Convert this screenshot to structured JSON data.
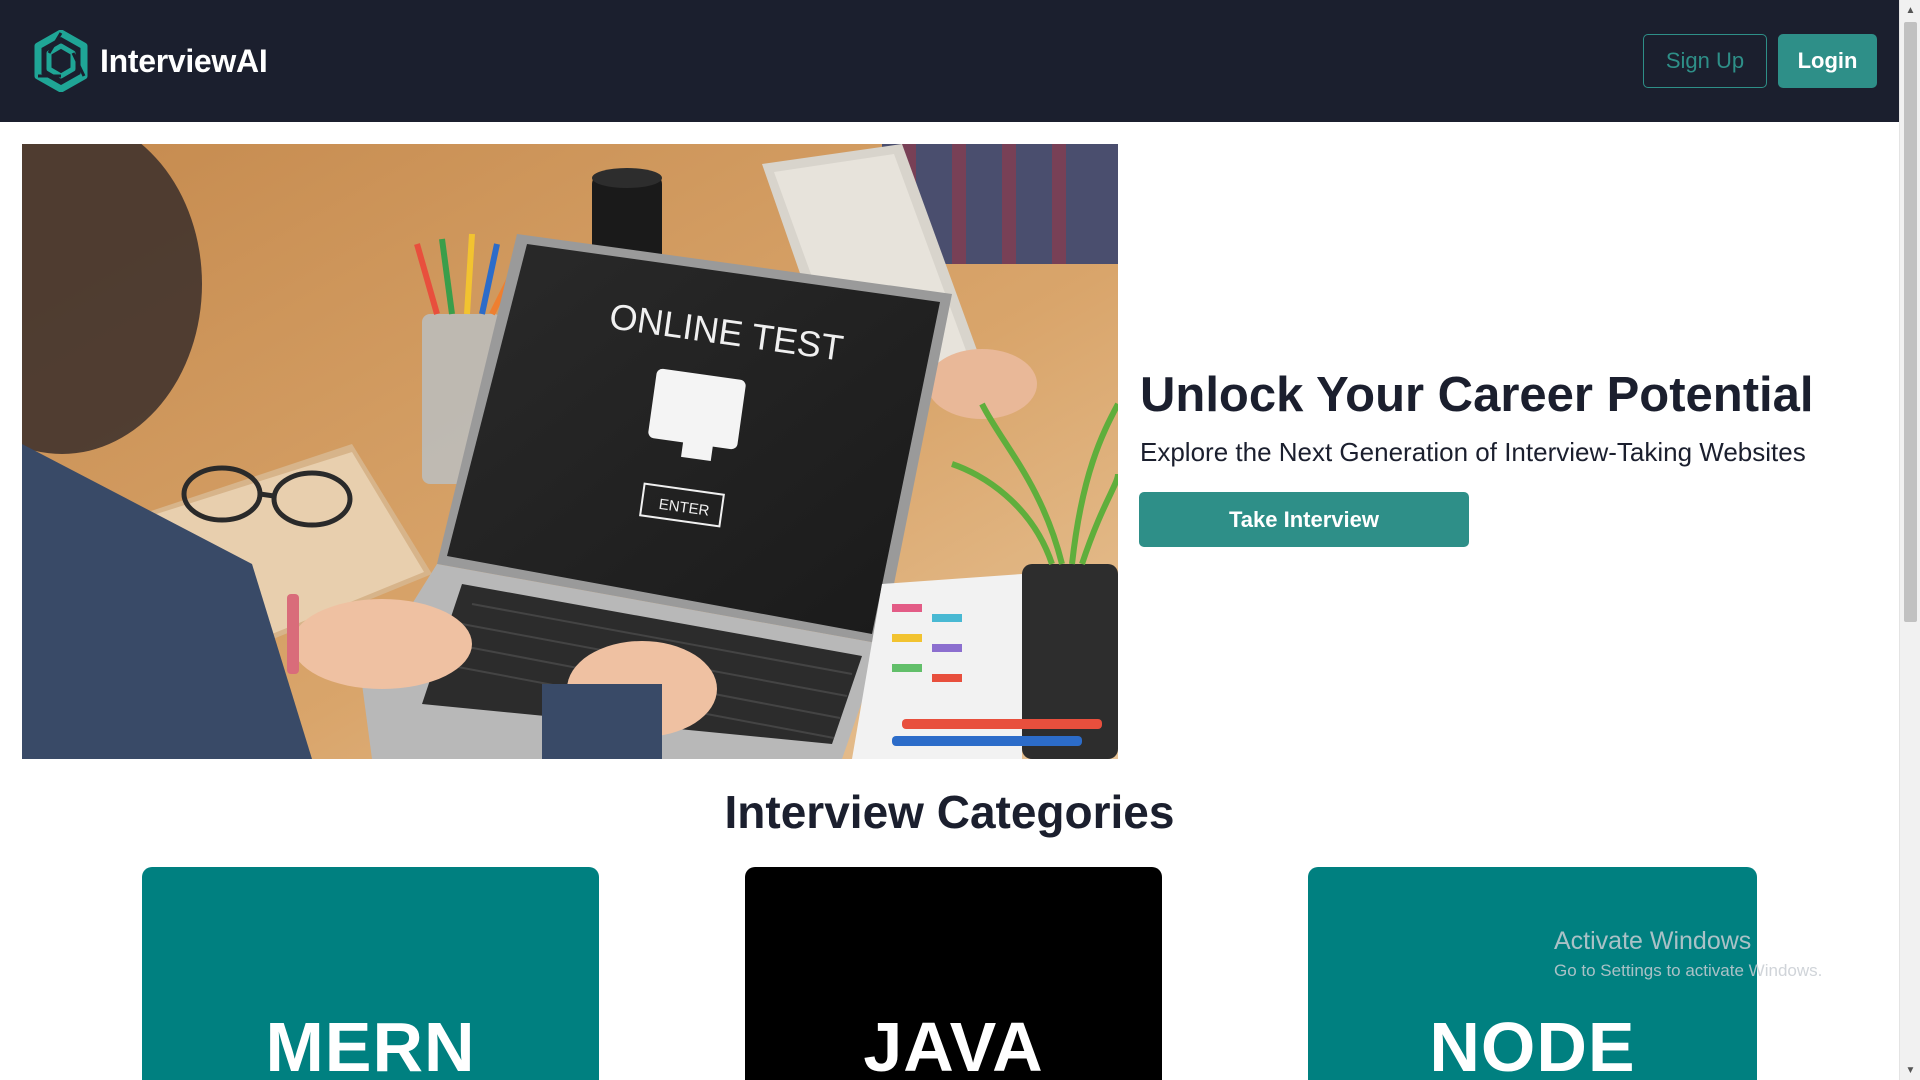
{
  "navbar": {
    "brand_name": "InterviewAI",
    "signup_label": "Sign Up",
    "login_label": "Login"
  },
  "hero": {
    "image_screen_title": "ONLINE TEST",
    "image_screen_key": "ENTER",
    "title": "Unlock Your Career Potential",
    "subtitle": "Explore the Next Generation of Interview-Taking Websites",
    "cta_label": "Take Interview"
  },
  "categories": {
    "title": "Interview Categories",
    "items": [
      {
        "label": "MERN",
        "color": "#008080"
      },
      {
        "label": "JAVA",
        "color": "#000000"
      },
      {
        "label": "NODE",
        "color": "#008080"
      }
    ]
  },
  "watermark": {
    "title": "Activate Windows",
    "subtitle": "Go to Settings to activate Windows."
  },
  "colors": {
    "navbar_bg": "#1b1f2e",
    "accent": "#2e8f88",
    "heading": "#1b1f2e"
  },
  "icons": {
    "brand_logo": "hexagon-logo-icon",
    "scroll_up": "triangle-up-icon",
    "scroll_down": "triangle-down-icon"
  }
}
